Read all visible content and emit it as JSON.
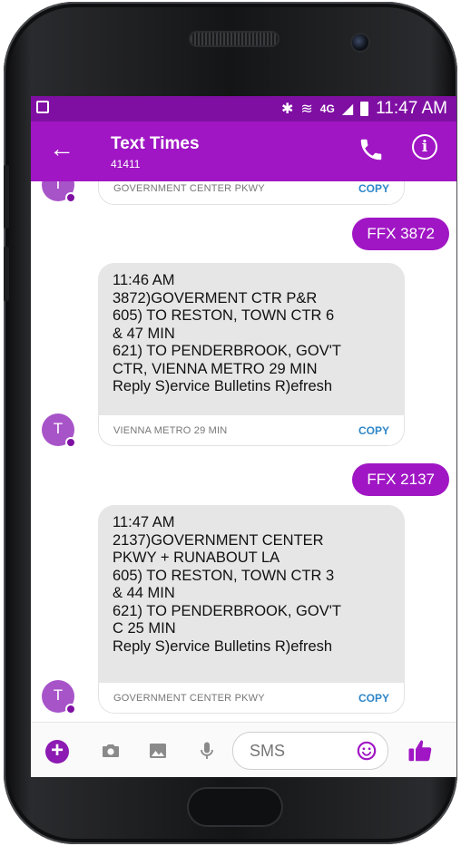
{
  "status_bar": {
    "time": "11:47 AM",
    "bluetooth_icon": "bluetooth-icon",
    "wifi_icon": "wifi-icon",
    "network": "4G",
    "signal_icon": "signal-icon",
    "battery_icon": "battery-icon"
  },
  "app_bar": {
    "title": "Text Times",
    "subtitle": "41411",
    "back_icon": "arrow-back-icon",
    "call_icon": "phone-icon",
    "info_label": "i"
  },
  "accent_color": "#a016c4",
  "status_color": "#7f0fa3",
  "messages": [
    {
      "type": "preview",
      "avatar": "T",
      "preview_text": "GOVERNMENT CENTER PKWY",
      "copy_label": "COPY"
    },
    {
      "type": "outgoing",
      "text": "FFX 3872"
    },
    {
      "type": "incoming",
      "avatar": "T",
      "lines": [
        "11:46 AM",
        "3872)GOVERMENT CTR P&R",
        "605) TO RESTON, TOWN CTR 6",
        "& 47 MIN",
        "621) TO PENDERBROOK, GOV'T",
        "CTR, VIENNA METRO 29 MIN",
        "Reply S)ervice Bulletins R)efresh"
      ],
      "preview_text": "VIENNA METRO 29 MIN",
      "copy_label": "COPY"
    },
    {
      "type": "outgoing",
      "text": "FFX 2137"
    },
    {
      "type": "incoming",
      "avatar": "T",
      "lines": [
        "11:47 AM",
        "2137)GOVERNMENT CENTER",
        "PKWY + RUNABOUT LA",
        "605) TO RESTON, TOWN CTR 3",
        "& 44 MIN",
        "621) TO PENDERBROOK, GOV'T",
        "C 25 MIN",
        "Reply S)ervice Bulletins R)efresh"
      ],
      "preview_text": "GOVERNMENT CENTER PKWY",
      "copy_label": "COPY"
    }
  ],
  "composer": {
    "placeholder": "SMS",
    "plus_label": "+",
    "icons": [
      "add-icon",
      "camera-icon",
      "gallery-icon",
      "microphone-icon",
      "emoji-icon",
      "thumbs-up-icon"
    ]
  }
}
